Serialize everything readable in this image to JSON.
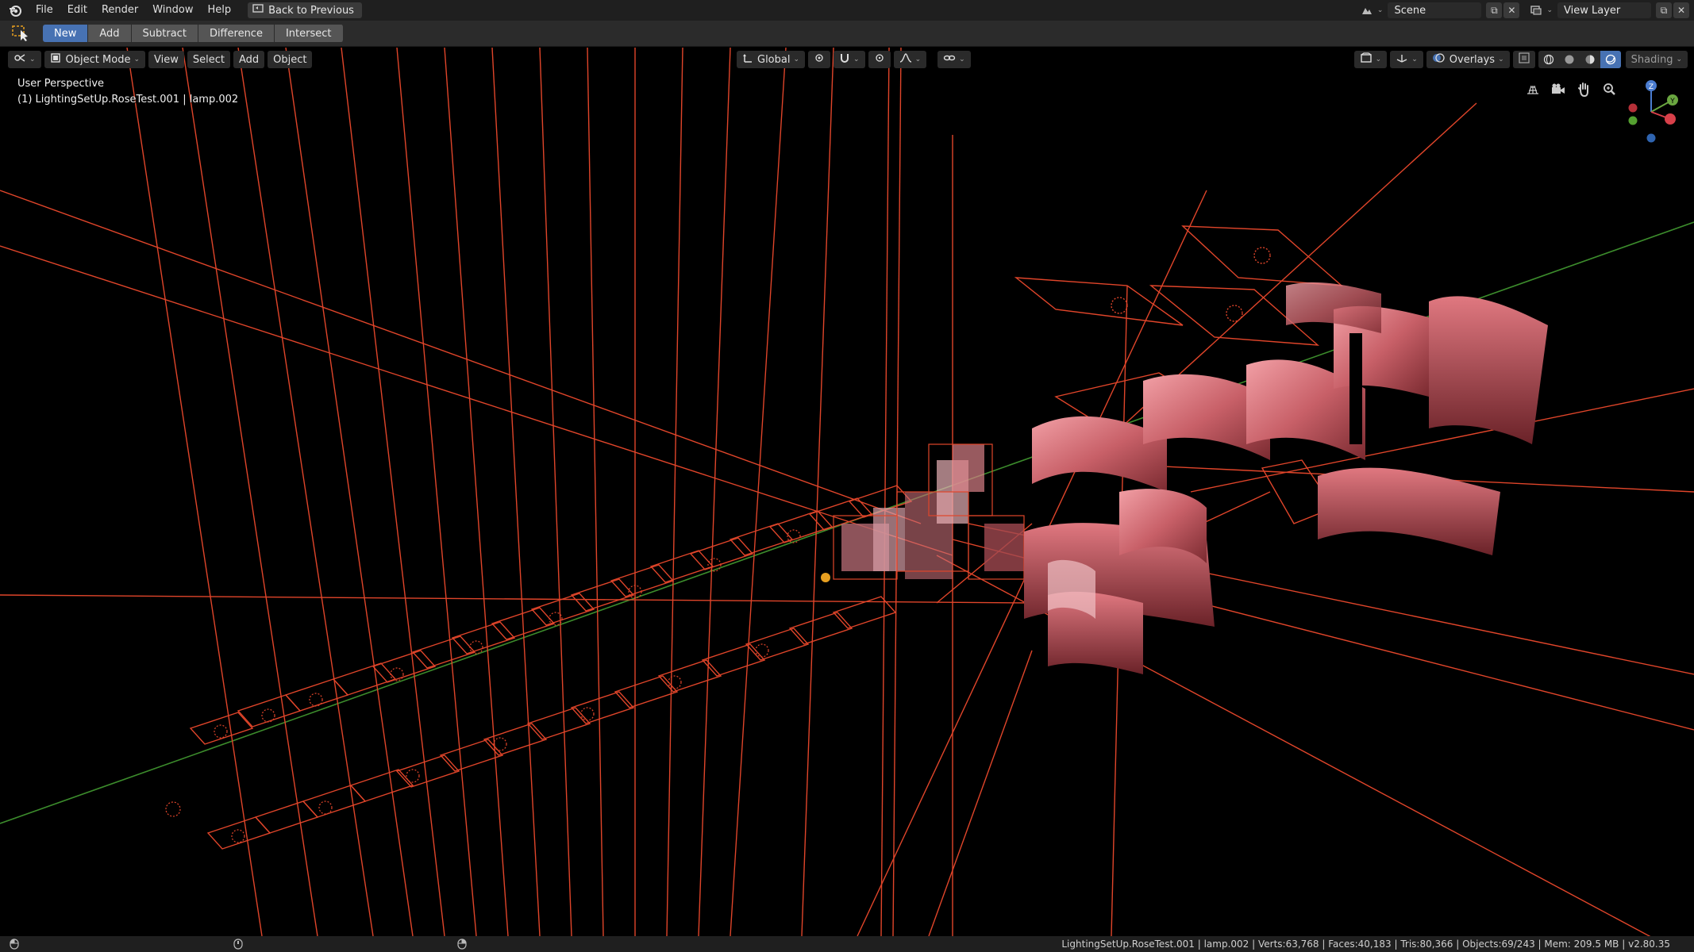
{
  "menubar": {
    "items": [
      "File",
      "Edit",
      "Render",
      "Window",
      "Help"
    ],
    "back_button": "Back to Previous",
    "scene_name": "Scene",
    "view_layer": "View Layer"
  },
  "toolbar": {
    "modes": [
      "New",
      "Add",
      "Subtract",
      "Difference",
      "Intersect"
    ],
    "active_mode": "New"
  },
  "viewport_header": {
    "interaction_mode": "Object Mode",
    "menus": [
      "View",
      "Select",
      "Add",
      "Object"
    ],
    "transform_orientation": "Global",
    "overlays_label": "Overlays",
    "shading_label": "Shading"
  },
  "viewport": {
    "perspective_label": "User Perspective",
    "active_object_label": "(1) LightingSetUp.RoseTest.001 | lamp.002"
  },
  "gizmo": {
    "x_label": "Y",
    "z_label": "Z"
  },
  "statusbar": {
    "stats": "LightingSetUp.RoseTest.001 | lamp.002 | Verts:63,768 | Faces:40,183 | Tris:80,366 | Objects:69/243 | Mem: 209.5 MB | v2.80.35"
  },
  "colors": {
    "accent": "#4772b3",
    "wire": "#e0452a",
    "mesh": "#e8868a",
    "background": "#000000"
  }
}
